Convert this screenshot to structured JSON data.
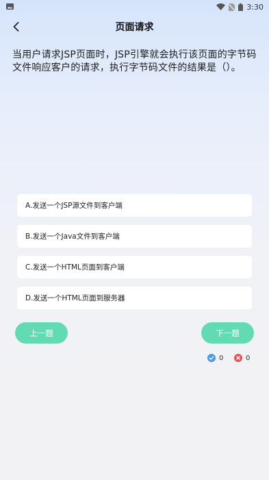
{
  "status_bar": {
    "time": "3:30"
  },
  "nav": {
    "title": "页面请求"
  },
  "question": {
    "text": "当用户请求JSP页面时，JSP引擎就会执行该页面的字节码文件响应客户的请求，执行字节码文件的结果是（）。"
  },
  "options": [
    {
      "label": "A.发送一个JSP源文件到客户端"
    },
    {
      "label": "B.发送一个Java文件到客户端"
    },
    {
      "label": "C.发送一个HTML页面到客户端"
    },
    {
      "label": "D.发送一个HTML页面到服务器"
    }
  ],
  "buttons": {
    "prev_label": "上一题",
    "next_label": "下一题"
  },
  "score": {
    "correct_count": "0",
    "wrong_count": "0"
  },
  "colors": {
    "accent": "#63dbb2",
    "correct": "#4a9be0",
    "wrong": "#e05656"
  },
  "icons": {
    "back": "chevron-left-icon",
    "correct": "check-circle-icon",
    "wrong": "x-circle-icon"
  }
}
